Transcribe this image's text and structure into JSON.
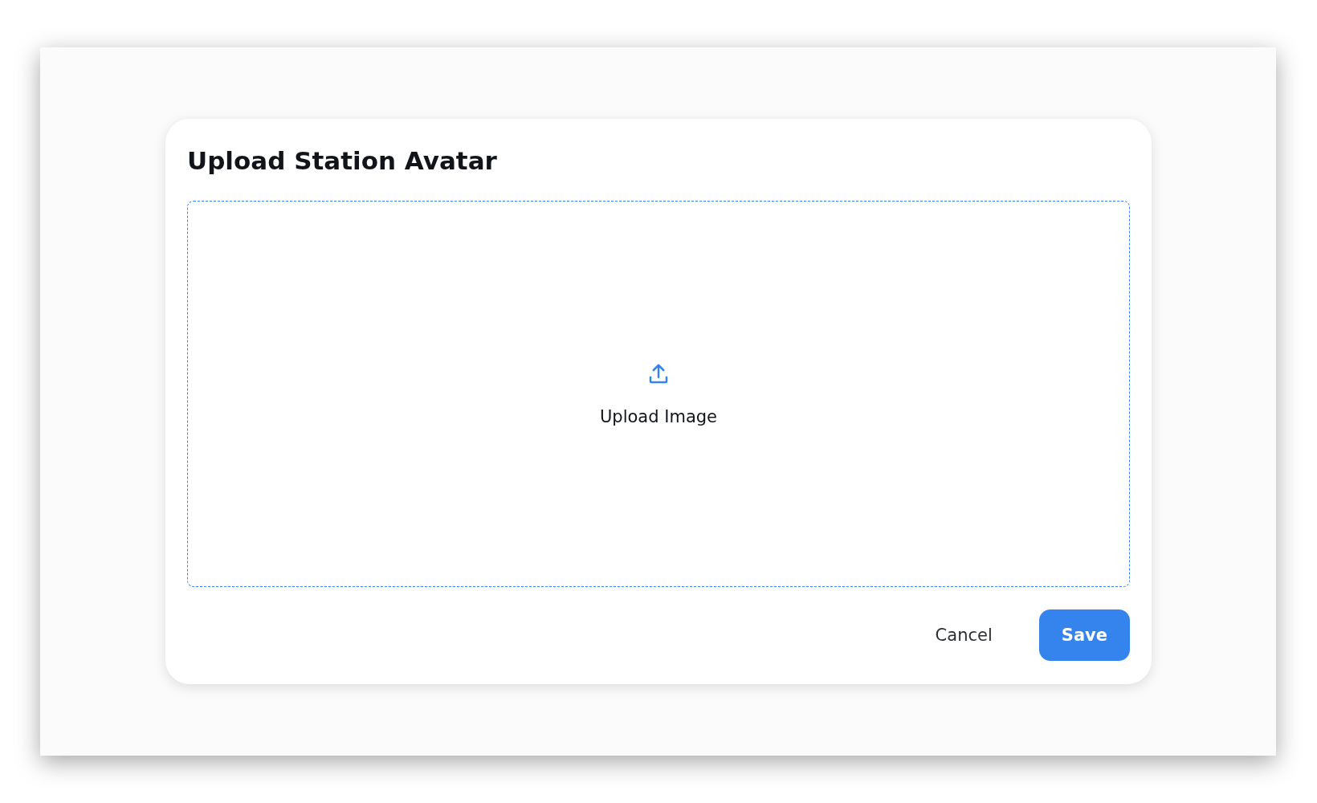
{
  "dialog": {
    "title": "Upload Station Avatar",
    "dropzone": {
      "label": "Upload Image"
    },
    "buttons": [
      {
        "label": "Cancel",
        "kind": "secondary"
      },
      {
        "label": "Save",
        "kind": "primary"
      }
    ]
  }
}
